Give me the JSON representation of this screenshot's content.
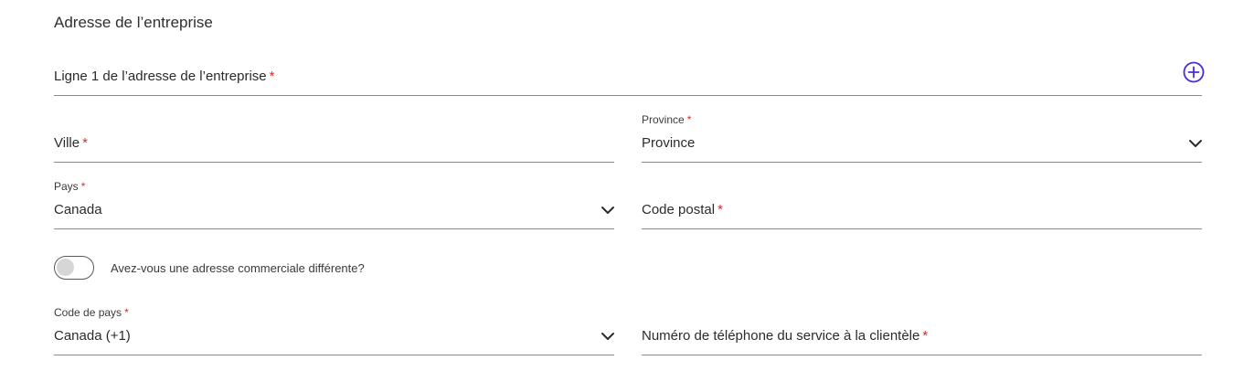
{
  "section": {
    "title": "Adresse de l’entreprise"
  },
  "address_line1": {
    "label": "Ligne 1 de l’adresse de l’entreprise",
    "required": "*"
  },
  "city": {
    "label": "Ville",
    "required": "*"
  },
  "province": {
    "label": "Province",
    "required": "*",
    "value": "Province"
  },
  "country": {
    "label": "Pays",
    "required": "*",
    "value": "Canada"
  },
  "postal_code": {
    "label": "Code postal",
    "required": "*"
  },
  "toggle": {
    "label": "Avez-vous une adresse commerciale différente?",
    "checked": false
  },
  "country_code": {
    "label": "Code de pays",
    "required": "*",
    "value": "Canada (+1)"
  },
  "phone": {
    "label": "Numéro de téléphone du service à la clientèle",
    "required": "*"
  },
  "colors": {
    "accent": "#4a2bdb",
    "required": "#d22d2d",
    "underline": "#8a8a8a"
  },
  "icons": {
    "add": "plus-circle-icon",
    "dropdown": "chevron-down-icon"
  }
}
